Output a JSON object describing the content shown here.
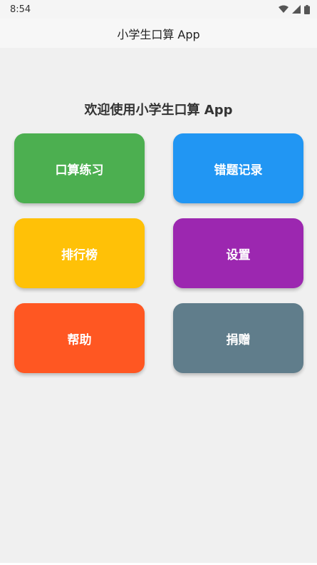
{
  "status_bar": {
    "time": "8:54",
    "icons": [
      "wifi-icon",
      "cell-signal-icon",
      "battery-icon"
    ]
  },
  "app_bar": {
    "title": "小学生口算 App"
  },
  "home": {
    "welcome": "欢迎使用小学生口算 App",
    "tiles": [
      {
        "label": "口算练习",
        "color": "#4CAF50"
      },
      {
        "label": "错题记录",
        "color": "#2196F3"
      },
      {
        "label": "排行榜",
        "color": "#FFC107"
      },
      {
        "label": "设置",
        "color": "#9C27B0"
      },
      {
        "label": "帮助",
        "color": "#FF5722"
      },
      {
        "label": "捐赠",
        "color": "#607D8B"
      }
    ]
  }
}
